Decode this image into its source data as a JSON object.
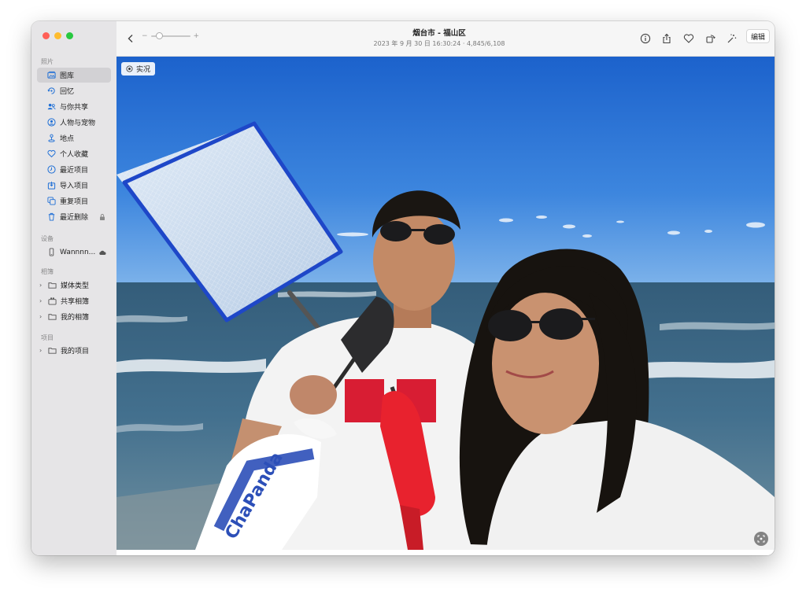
{
  "window": {
    "title": "烟台市 - 福山区",
    "subtitle": "2023 年 9 月 30 日 16:30:24  ·  4,845/6,108"
  },
  "toolbar": {
    "zoom_minus": "−",
    "zoom_plus": "+",
    "edit_label": "编辑",
    "icons": [
      "back-chevron-icon",
      "info-icon",
      "share-icon",
      "heart-icon",
      "rotate-icon",
      "enhance-icon"
    ]
  },
  "sidebar": {
    "sections": {
      "photos": "照片",
      "devices": "设备",
      "albums": "相簿",
      "projects": "项目"
    },
    "library_items": [
      {
        "label": "图库",
        "icon": "photo-library-icon",
        "selected": true
      },
      {
        "label": "回忆",
        "icon": "memories-icon"
      },
      {
        "label": "与你共享",
        "icon": "shared-with-you-icon"
      },
      {
        "label": "人物与宠物",
        "icon": "people-icon"
      },
      {
        "label": "地点",
        "icon": "places-icon"
      },
      {
        "label": "个人收藏",
        "icon": "favorites-icon"
      },
      {
        "label": "最近项目",
        "icon": "recents-icon"
      },
      {
        "label": "导入项目",
        "icon": "imports-icon"
      },
      {
        "label": "重复项目",
        "icon": "duplicates-icon"
      },
      {
        "label": "最近删除",
        "icon": "trash-icon"
      }
    ],
    "devices": [
      {
        "label": "Wannnn...",
        "icon": "phone-icon"
      }
    ],
    "albums": [
      {
        "label": "媒体类型",
        "icon": "folder-icon"
      },
      {
        "label": "共享相簿",
        "icon": "shared-album-icon"
      },
      {
        "label": "我的相簿",
        "icon": "folder-icon"
      }
    ],
    "projects": [
      {
        "label": "我的项目",
        "icon": "folder-icon"
      }
    ]
  },
  "photo": {
    "live_label": "实况",
    "shirt_text": "图址",
    "bag_text": "ChaPanda",
    "bag_small_text": "more the better taste"
  },
  "colors": {
    "sidebar_bg": "#e6e5e7",
    "selected_bg": "#d2d1d4",
    "sky_top": "#1f6fd6",
    "sea": "#3b6b8c",
    "shovel_red": "#e8222e",
    "net_blue": "#1e47c8"
  }
}
